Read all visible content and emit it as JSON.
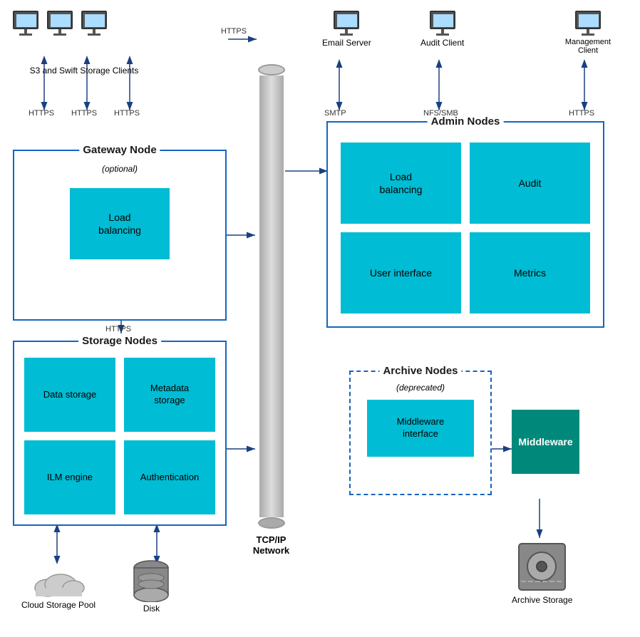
{
  "clients": {
    "s3_swift_label": "S3 and Swift Storage Clients",
    "email_server_label": "Email Server",
    "audit_client_label": "Audit Client",
    "management_client_label": "Management Client"
  },
  "protocols": {
    "https1": "HTTPS",
    "https2": "HTTPS",
    "https3": "HTTPS",
    "https4": "HTTPS",
    "https5": "HTTPS",
    "smtp": "SMTP",
    "nfs_smb": "NFS/SMB",
    "https_gw": "HTTPS"
  },
  "gateway_node": {
    "title": "Gateway Node",
    "subtitle": "(optional)",
    "load_balancing": "Load\nbalancing"
  },
  "admin_nodes": {
    "title": "Admin Nodes",
    "load_balancing": "Load\nbalancing",
    "audit": "Audit",
    "user_interface": "User interface",
    "metrics": "Metrics"
  },
  "storage_nodes": {
    "title": "Storage Nodes",
    "data_storage": "Data storage",
    "metadata_storage": "Metadata\nstorage",
    "ilm_engine": "ILM engine",
    "authentication": "Authentication"
  },
  "archive_nodes": {
    "title": "Archive Nodes",
    "subtitle": "(deprecated)",
    "middleware_interface": "Middleware\ninterface"
  },
  "middleware": {
    "label": "Middleware"
  },
  "bottom": {
    "cloud_storage": "Cloud Storage Pool",
    "disk": "Disk",
    "tcp_ip": "TCP/IP\nNetwork",
    "archive_storage": "Archive Storage"
  }
}
